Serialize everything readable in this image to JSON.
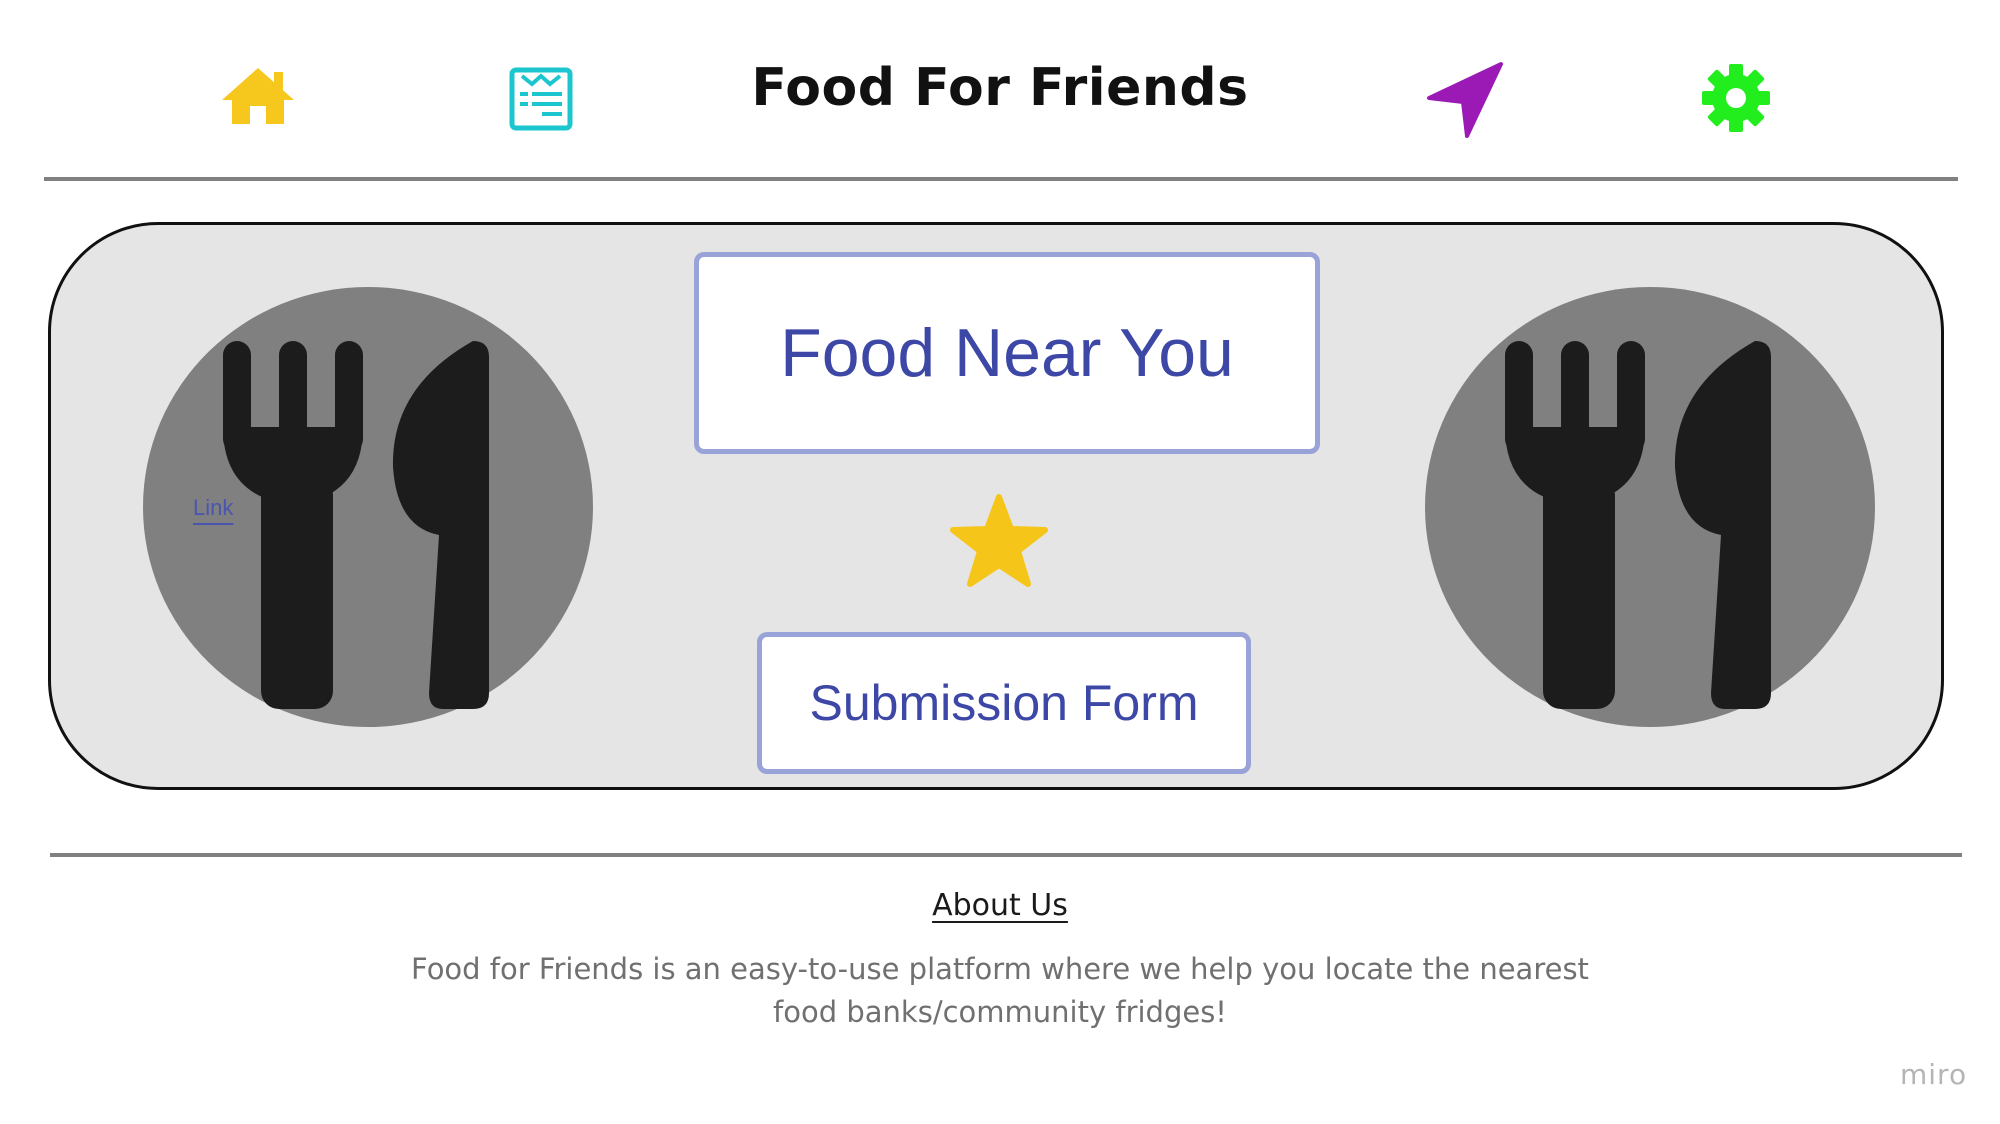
{
  "header": {
    "title": "Food For Friends",
    "icons": {
      "home": "home-icon",
      "form": "form-icon",
      "location": "location-arrow-icon",
      "settings": "gear-icon"
    },
    "colors": {
      "home": "#f6c81e",
      "form": "#1bc6cf",
      "location": "#9b19b5",
      "settings": "#22ee1e"
    }
  },
  "main": {
    "food_near_you_label": "Food Near You",
    "submission_form_label": "Submission Form",
    "left_plate_link": "Link",
    "star_icon": "star-icon",
    "star_color": "#f6c519",
    "button_border_color": "#9aa3d8",
    "button_text_color": "#3c47a6"
  },
  "about": {
    "heading": "About Us",
    "text": "Food for Friends is an easy-to-use platform where we help you locate the nearest food banks/community fridges!"
  },
  "watermark": "miro"
}
